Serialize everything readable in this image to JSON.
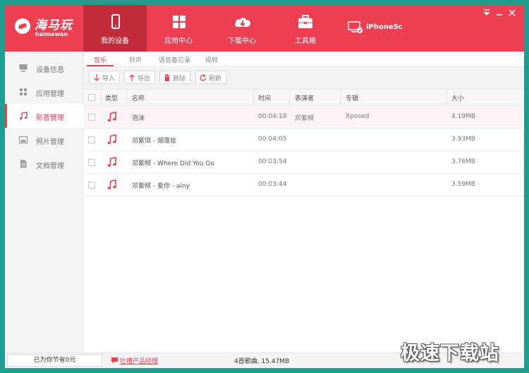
{
  "app": {
    "logo_cn": "海马玩",
    "logo_en": "haimawan",
    "brand_color": "#ed3f52"
  },
  "nav": {
    "tabs": [
      {
        "label": "我的设备",
        "icon": "phone-icon",
        "active": true
      },
      {
        "label": "应用中心",
        "icon": "grid-icon",
        "active": false
      },
      {
        "label": "下载中心",
        "icon": "cloud-download-icon",
        "active": false
      },
      {
        "label": "工具箱",
        "icon": "toolbox-icon",
        "active": false
      }
    ],
    "device_name": "iPhone5c"
  },
  "window_controls": [
    "menu-icon",
    "minimize-icon",
    "close-icon"
  ],
  "sidebar": {
    "items": [
      {
        "label": "设备信息",
        "icon": "monitor-icon",
        "active": false
      },
      {
        "label": "应用管理",
        "icon": "apps-icon",
        "active": false
      },
      {
        "label": "影音管理",
        "icon": "music-icon",
        "active": true
      },
      {
        "label": "照片管理",
        "icon": "photo-icon",
        "active": false
      },
      {
        "label": "文档管理",
        "icon": "document-icon",
        "active": false
      }
    ]
  },
  "subtabs": [
    {
      "label": "音乐",
      "active": true
    },
    {
      "label": "铃声",
      "active": false
    },
    {
      "label": "语音备忘录",
      "active": false
    },
    {
      "label": "视频",
      "active": false
    }
  ],
  "toolbar": {
    "import_label": "导入",
    "export_label": "导出",
    "delete_label": "删除",
    "refresh_label": "刷新"
  },
  "table": {
    "columns": [
      "类型",
      "名称",
      "时间",
      "表演者",
      "专辑",
      "大小"
    ],
    "rows": [
      {
        "name": "泡沫",
        "time": "00:04:18",
        "artist": "邓紫棋",
        "album": "Xposed",
        "size": "4.19MB"
      },
      {
        "name": "邓紫琪 - 烟霭妆",
        "time": "00:04:05",
        "artist": "",
        "album": "",
        "size": "3.93MB"
      },
      {
        "name": "邓紫棋 - Where Did You Go",
        "time": "00:03:54",
        "artist": "",
        "album": "",
        "size": "3.76MB"
      },
      {
        "name": "邓紫棋 - 爱你 - ainy",
        "time": "00:03:44",
        "artist": "",
        "album": "",
        "size": "3.59MB"
      }
    ]
  },
  "status": {
    "saved": "已为你节省0元",
    "feedback": "吐槽产品经理",
    "summary": "4首歌曲, 15.47MB"
  },
  "watermark": "极速下载站"
}
